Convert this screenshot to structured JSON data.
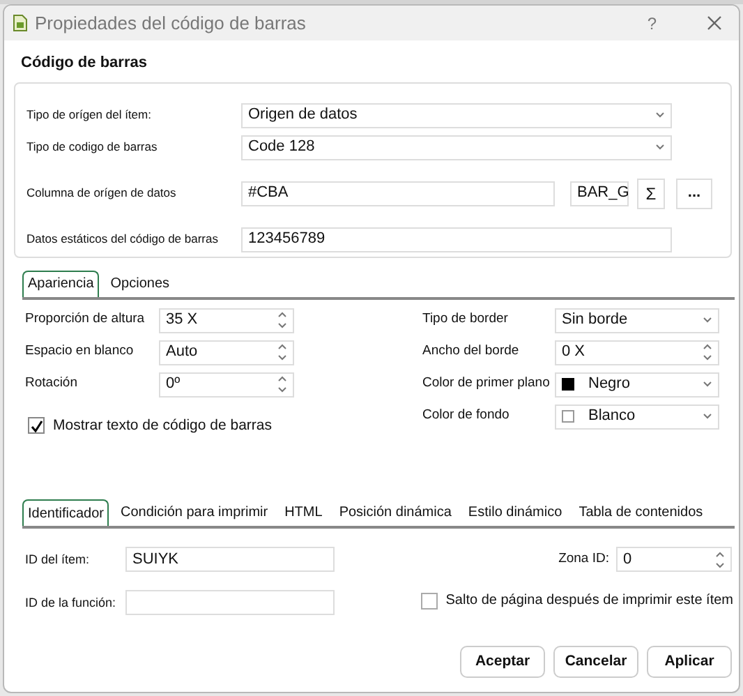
{
  "window": {
    "title": "Propiedades del código de barras",
    "help": "?"
  },
  "section_title": "Código de barras",
  "fields": [
    {
      "kind": "select",
      "label": "Tipo de orígen del ítem:",
      "value": "Origen de datos"
    },
    {
      "kind": "select",
      "label": "Tipo de codigo de barras",
      "value": "Code 128"
    },
    {
      "kind": "column",
      "label": "Columna de orígen de datos",
      "value": "#CBA",
      "column": "BAR_G",
      "sigma": "Σ",
      "button": "..."
    },
    {
      "kind": "text",
      "label": "Datos estáticos del código de barras",
      "value": "123456789"
    }
  ],
  "tabs": [
    {
      "label": "Apariencia",
      "selected": true
    },
    {
      "label": "Opciones",
      "selected": false
    }
  ],
  "appearance": {
    "left": [
      {
        "kind": "spin",
        "label": "Proporción de altura",
        "value": "35 X"
      },
      {
        "kind": "spin",
        "label": "Espacio en blanco",
        "value": "Auto"
      },
      {
        "kind": "spin",
        "label": "Rotación",
        "value": "0º"
      }
    ],
    "checkbox": {
      "label": "Mostrar texto de código de barras",
      "checked": true
    },
    "right": [
      {
        "kind": "select",
        "label": "Tipo de border",
        "value": "Sin borde"
      },
      {
        "kind": "spin",
        "label": "Ancho del borde",
        "value": "0 X"
      },
      {
        "kind": "color",
        "label": "Color de primer plano",
        "value": "Negro",
        "color": "#000000"
      },
      {
        "kind": "color",
        "label": "Color de fondo",
        "value": "Blanco",
        "color": "#ffffff"
      }
    ]
  },
  "bottom_tabs": [
    {
      "label": "Identificador",
      "selected": true
    },
    {
      "label": "Condición para imprimir",
      "selected": false
    },
    {
      "label": "HTML",
      "selected": false
    },
    {
      "label": "Posición dinámica",
      "selected": false
    },
    {
      "label": "Estilo dinámico",
      "selected": false
    },
    {
      "label": "Tabla de contenidos",
      "selected": false
    }
  ],
  "identifier": {
    "item_id": {
      "label": "ID del ítem:",
      "value": "SUIYK"
    },
    "function_id": {
      "label": "ID de la función:"
    },
    "zone_id": {
      "label": "Zona ID:",
      "value": "0"
    },
    "page_break": {
      "label": "Salto de página después de imprimir este ítem",
      "checked": false
    }
  },
  "buttons": [
    "Aceptar",
    "Cancelar",
    "Aplicar"
  ]
}
